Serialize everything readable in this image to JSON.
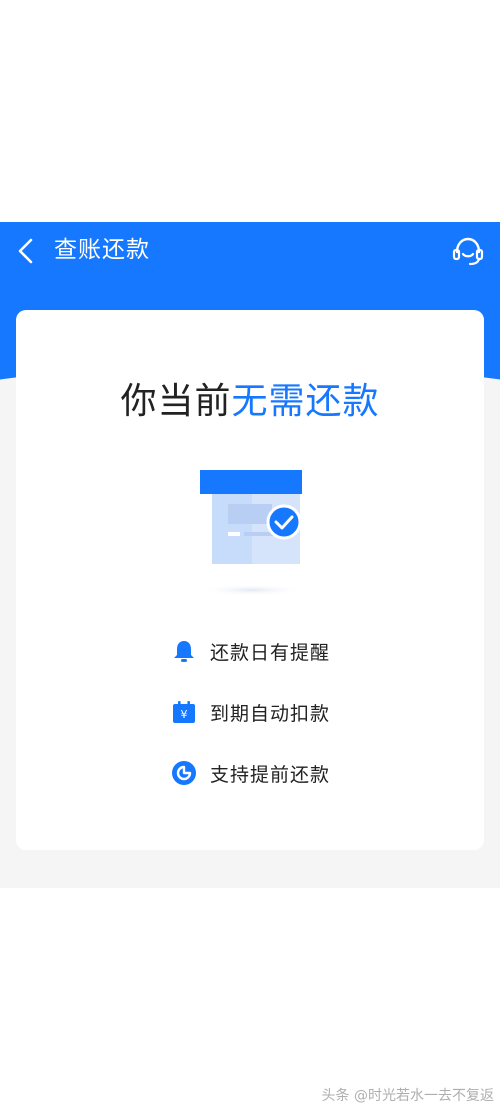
{
  "header": {
    "title": "查账还款",
    "back_icon": "chevron-left-icon",
    "service_icon": "customer-service-headset-icon"
  },
  "main": {
    "headline_prefix": "你当前",
    "headline_highlight": "无需还款",
    "illustration_icon": "bill-with-checkmark-icon"
  },
  "features": [
    {
      "label": "还款日有提醒",
      "icon": "bell-icon"
    },
    {
      "label": "到期自动扣款",
      "icon": "calendar-yen-icon"
    },
    {
      "label": "支持提前还款",
      "icon": "clock-circle-icon"
    }
  ],
  "watermark": "头条 @时光若水一去不复返",
  "colors": {
    "brand_blue": "#1677ff",
    "background_gray": "#f5f5f5",
    "text_dark": "#222222"
  }
}
